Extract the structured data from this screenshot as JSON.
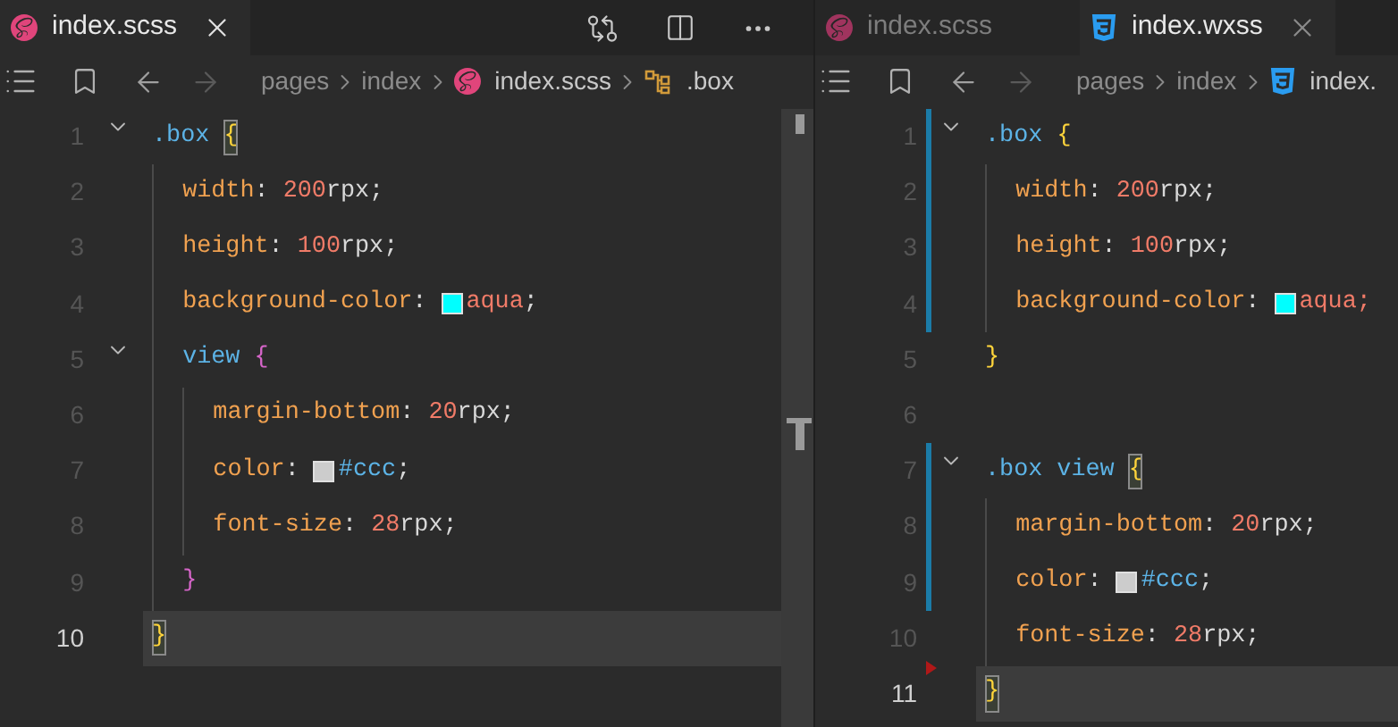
{
  "panes": [
    {
      "tabs": [
        {
          "label": "index.scss",
          "kind": "sass",
          "selected": true,
          "closable": true
        }
      ],
      "actions": true,
      "breadcrumb": [
        {
          "text": "pages"
        },
        {
          "text": "index"
        },
        {
          "text": "index.scss",
          "kind": "sass"
        },
        {
          "text": ".box",
          "kind": "symbol"
        }
      ],
      "lines": [
        {
          "number": "1",
          "current": false,
          "foldable": true,
          "tokens": [
            {
              "kind": "selector",
              "text": ".box"
            },
            {
              "kind": "brace",
              "text": " {",
              "matched": true
            }
          ]
        },
        {
          "number": "2",
          "current": false,
          "tokens": [
            {
              "kind": "property",
              "text": "  width"
            },
            {
              "kind": "plain",
              "text": ": "
            },
            {
              "kind": "number",
              "text": "200"
            },
            {
              "kind": "plain",
              "text": "rpx;"
            }
          ]
        },
        {
          "number": "3",
          "current": false,
          "tokens": [
            {
              "kind": "property",
              "text": "  height"
            },
            {
              "kind": "plain",
              "text": ": "
            },
            {
              "kind": "number",
              "text": "100"
            },
            {
              "kind": "plain",
              "text": "rpx;"
            }
          ]
        },
        {
          "number": "4",
          "current": false,
          "tokens": [
            {
              "kind": "property",
              "text": "  background-color"
            },
            {
              "kind": "plain",
              "text": ": "
            },
            {
              "kind": "swatch",
              "color": "#00ffff"
            },
            {
              "kind": "number",
              "text": "aqua"
            },
            {
              "kind": "plain",
              "text": ";"
            }
          ]
        },
        {
          "number": "5",
          "current": false,
          "foldable": true,
          "tokens": [
            {
              "kind": "selector",
              "text": "  view"
            },
            {
              "kind": "brace2",
              "text": " {"
            }
          ]
        },
        {
          "number": "6",
          "current": false,
          "tokens": [
            {
              "kind": "property",
              "text": "    margin-bottom"
            },
            {
              "kind": "plain",
              "text": ": "
            },
            {
              "kind": "number",
              "text": "20"
            },
            {
              "kind": "plain",
              "text": "rpx;"
            }
          ]
        },
        {
          "number": "7",
          "current": false,
          "tokens": [
            {
              "kind": "property",
              "text": "    color"
            },
            {
              "kind": "plain",
              "text": ": "
            },
            {
              "kind": "swatch",
              "color": "#cccccc"
            },
            {
              "kind": "selector",
              "text": "#ccc"
            },
            {
              "kind": "plain",
              "text": ";"
            }
          ]
        },
        {
          "number": "8",
          "current": false,
          "tokens": [
            {
              "kind": "property",
              "text": "    font-size"
            },
            {
              "kind": "plain",
              "text": ": "
            },
            {
              "kind": "number",
              "text": "28"
            },
            {
              "kind": "plain",
              "text": "rpx;"
            }
          ]
        },
        {
          "number": "9",
          "current": false,
          "tokens": [
            {
              "kind": "brace2",
              "text": "  }"
            }
          ]
        },
        {
          "number": "10",
          "current": true,
          "tokens": [
            {
              "kind": "brace",
              "text": "}",
              "matched": true
            }
          ]
        }
      ],
      "scrollbar": true
    },
    {
      "tabs": [
        {
          "label": "index.scss",
          "kind": "sass",
          "selected": false,
          "closable": false
        },
        {
          "label": "index.wxss",
          "kind": "css",
          "selected": true,
          "closable": true
        }
      ],
      "actions": false,
      "breadcrumb": [
        {
          "text": "pages"
        },
        {
          "text": "index"
        },
        {
          "text": "index.",
          "kind": "css"
        }
      ],
      "lines": [
        {
          "number": "1",
          "current": false,
          "foldable": true,
          "modified": true,
          "tokens": [
            {
              "kind": "selector",
              "text": ".box"
            },
            {
              "kind": "brace",
              "text": " {",
              "matched": false
            }
          ]
        },
        {
          "number": "2",
          "current": false,
          "modified": true,
          "tokens": [
            {
              "kind": "property",
              "text": "  width"
            },
            {
              "kind": "plain",
              "text": ": "
            },
            {
              "kind": "number",
              "text": "200"
            },
            {
              "kind": "plain",
              "text": "rpx;"
            }
          ]
        },
        {
          "number": "3",
          "current": false,
          "modified": true,
          "tokens": [
            {
              "kind": "property",
              "text": "  height"
            },
            {
              "kind": "plain",
              "text": ": "
            },
            {
              "kind": "number",
              "text": "100"
            },
            {
              "kind": "plain",
              "text": "rpx;"
            }
          ]
        },
        {
          "number": "4",
          "current": false,
          "modified": true,
          "tokens": [
            {
              "kind": "property",
              "text": "  background-color"
            },
            {
              "kind": "plain",
              "text": ": "
            },
            {
              "kind": "swatch",
              "color": "#00ffff"
            },
            {
              "kind": "number",
              "text": "aqua;"
            }
          ]
        },
        {
          "number": "5",
          "current": false,
          "tokens": [
            {
              "kind": "brace",
              "text": "}",
              "matched": false
            }
          ]
        },
        {
          "number": "6",
          "current": false
        },
        {
          "number": "7",
          "current": false,
          "foldable": true,
          "modified": true,
          "tokens": [
            {
              "kind": "selector",
              "text": ".box view"
            },
            {
              "kind": "brace",
              "text": " {",
              "matched": true
            }
          ]
        },
        {
          "number": "8",
          "current": false,
          "modified": true,
          "tokens": [
            {
              "kind": "property",
              "text": "  margin-bottom"
            },
            {
              "kind": "plain",
              "text": ": "
            },
            {
              "kind": "number",
              "text": "20"
            },
            {
              "kind": "plain",
              "text": "rpx;"
            }
          ]
        },
        {
          "number": "9",
          "current": false,
          "modified": true,
          "tokens": [
            {
              "kind": "property",
              "text": "  color"
            },
            {
              "kind": "plain",
              "text": ": "
            },
            {
              "kind": "swatch",
              "color": "#cccccc"
            },
            {
              "kind": "selector",
              "text": "#ccc"
            },
            {
              "kind": "plain",
              "text": ";"
            }
          ]
        },
        {
          "number": "10",
          "current": false,
          "deleted_below": true,
          "tokens": [
            {
              "kind": "property",
              "text": "  font-size"
            },
            {
              "kind": "plain",
              "text": ": "
            },
            {
              "kind": "number",
              "text": "28"
            },
            {
              "kind": "plain",
              "text": "rpx;"
            }
          ]
        },
        {
          "number": "11",
          "current": true,
          "tokens": [
            {
              "kind": "brace",
              "text": "}",
              "matched": true
            }
          ]
        }
      ],
      "scrollbar": false
    }
  ]
}
